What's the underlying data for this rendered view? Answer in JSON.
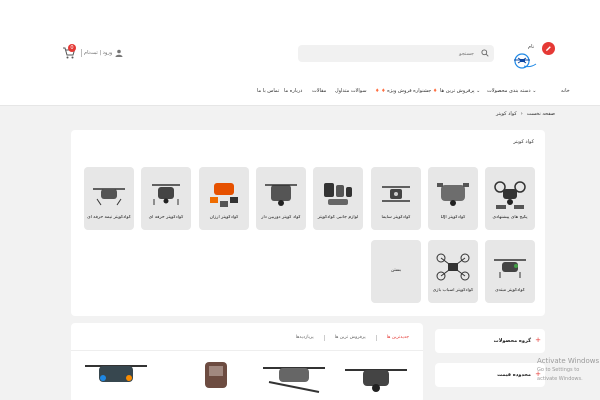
{
  "header": {
    "login_label": "ورود | ثبت‌نام",
    "cart_count": "0",
    "search_placeholder": "جستجو",
    "brand_text": "نام"
  },
  "nav": {
    "items": [
      "خانه",
      "دسته بندی محصولات",
      "پرفروش ترین ها",
      "جشنواره فروش ویژه",
      "سوالات متداول",
      "مقالات",
      "درباره ما",
      "تماس با ما"
    ]
  },
  "breadcrumb": {
    "home": "صفحه نخست",
    "current": "کواد کوپتر"
  },
  "category_panel": {
    "title": "کواد کوپتر",
    "tiles": [
      "پکیج های پیشنهادی",
      "کوادکوپتر DJI",
      "کوادکوپتر سایما",
      "لوازم جانبی کوادکوپتر",
      "کواد کوپتر دوربین دار",
      "کوادکوپتر ارزان",
      "کوادکوپتر حرفه ای",
      "کوادکوپتر نیمه حرفه ای",
      "کوادکوپتر مبتدی",
      "کوادکوپتر اسباب بازی",
      "بستن"
    ]
  },
  "product_tabs": {
    "items": [
      "جدیدترین ها",
      "پرفروش ترین ها",
      "پربازدیدها"
    ]
  },
  "sidebar": {
    "groups": [
      "گروه محصولات",
      "محدوده قیمت"
    ]
  },
  "watermark": {
    "line1": "Activate Windows",
    "line2": "Go to Settings to activate Windows."
  },
  "colors": {
    "accent": "#e53935",
    "tile_bg": "#e7e7e7",
    "page_bg": "#f2f2f2"
  }
}
